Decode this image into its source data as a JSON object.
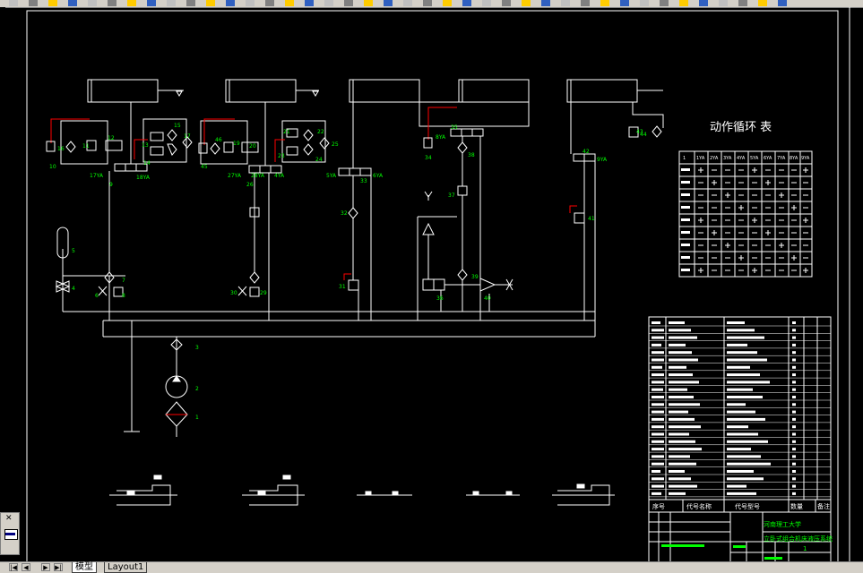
{
  "tabs": {
    "model": "模型",
    "layout1": "Layout1"
  },
  "nav": {
    "first": "|◀",
    "prev": "◀",
    "next": "▶",
    "last": "▶|"
  },
  "cycle_table": {
    "title": "动作循环 表",
    "header_corner": "1",
    "headers": [
      "1YA",
      "2YA",
      "3YA",
      "4YA",
      "5YA",
      "6YA",
      "7YA",
      "8YA",
      "9YA"
    ]
  },
  "labels": {
    "c1": [
      "16",
      "15",
      "12",
      "13",
      "14",
      "17",
      "11",
      "10",
      "9",
      "17YA",
      "18YA"
    ],
    "c2": [
      "21",
      "22",
      "20",
      "19",
      "23",
      "25",
      "24",
      "26",
      "27YA",
      "28YA",
      "4YA",
      "46",
      "45"
    ],
    "c3": [
      "32",
      "33",
      "5YA",
      "6YA"
    ],
    "c4": [
      "35",
      "8YA",
      "34",
      "38",
      "37",
      "39",
      "40",
      "36"
    ],
    "c5": [
      "44",
      "43",
      "42",
      "9YA",
      "41"
    ],
    "lower": [
      "5",
      "4",
      "7",
      "6",
      "8",
      "31",
      "30",
      "29"
    ],
    "pump": [
      "3",
      "2",
      "1"
    ]
  },
  "title_block": {
    "university": "河南理工大学",
    "drawing_title": "立卧式组合机床液压系统",
    "col_seq": "序号",
    "col_name": "代号名称",
    "col_code": "代号型号",
    "col_qty": "数量",
    "col_remark": "备注",
    "sheet": "1"
  },
  "colors": {
    "bg": "#000000",
    "line": "#ffffff",
    "label": "#00ff00",
    "accent": "#ff0000"
  }
}
